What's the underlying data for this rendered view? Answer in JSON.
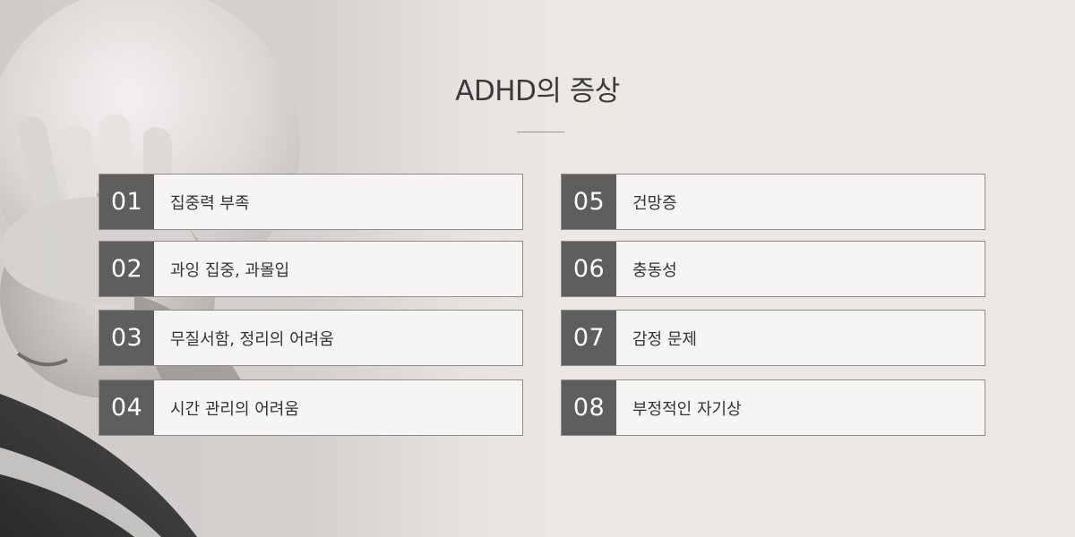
{
  "heading": {
    "title": "ADHD의 증상"
  },
  "symptoms": {
    "left": [
      {
        "number": "01",
        "label": "집중력 부족"
      },
      {
        "number": "02",
        "label": "과잉 집중, 과몰입"
      },
      {
        "number": "03",
        "label": "무질서함, 정리의 어려움"
      },
      {
        "number": "04",
        "label": "시간 관리의 어려움"
      }
    ],
    "right": [
      {
        "number": "05",
        "label": "건망증"
      },
      {
        "number": "06",
        "label": "충동성"
      },
      {
        "number": "07",
        "label": "감정 문제"
      },
      {
        "number": "08",
        "label": "부정적인 자기상"
      }
    ]
  },
  "colors": {
    "background": "#ebe7e3",
    "number_box": "#5e5e5e",
    "card": "#f7f5f3",
    "border": "#8e8c8a",
    "text": "#333333"
  }
}
